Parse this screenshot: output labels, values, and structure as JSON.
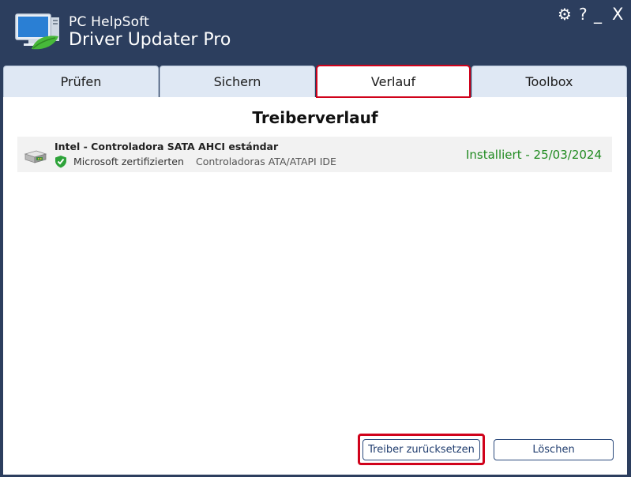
{
  "app": {
    "brand_line1": "PC HelpSoft",
    "brand_line2": "Driver Updater Pro"
  },
  "window_controls": {
    "settings": "⚙",
    "help": "?",
    "minimize": "_",
    "close": "X"
  },
  "tabs": [
    {
      "label": "Prüfen"
    },
    {
      "label": "Sichern"
    },
    {
      "label": "Verlauf",
      "active": true
    },
    {
      "label": "Toolbox"
    }
  ],
  "main": {
    "title": "Treiberverlauf",
    "history": [
      {
        "name": "Intel - Controladora SATA AHCI estándar",
        "certification": "Microsoft zertifizierten",
        "category": "Controladoras ATA/ATAPI IDE",
        "status": "Installiert - 25/03/2024"
      }
    ]
  },
  "buttons": {
    "reset": "Treiber zurücksetzen",
    "delete": "Löschen"
  },
  "colors": {
    "titlebar": "#2c3e5e",
    "tab_bg": "#dfe8f4",
    "highlight": "#d0021b",
    "status_green": "#1f8a1f",
    "button_border": "#2c4a7c"
  }
}
